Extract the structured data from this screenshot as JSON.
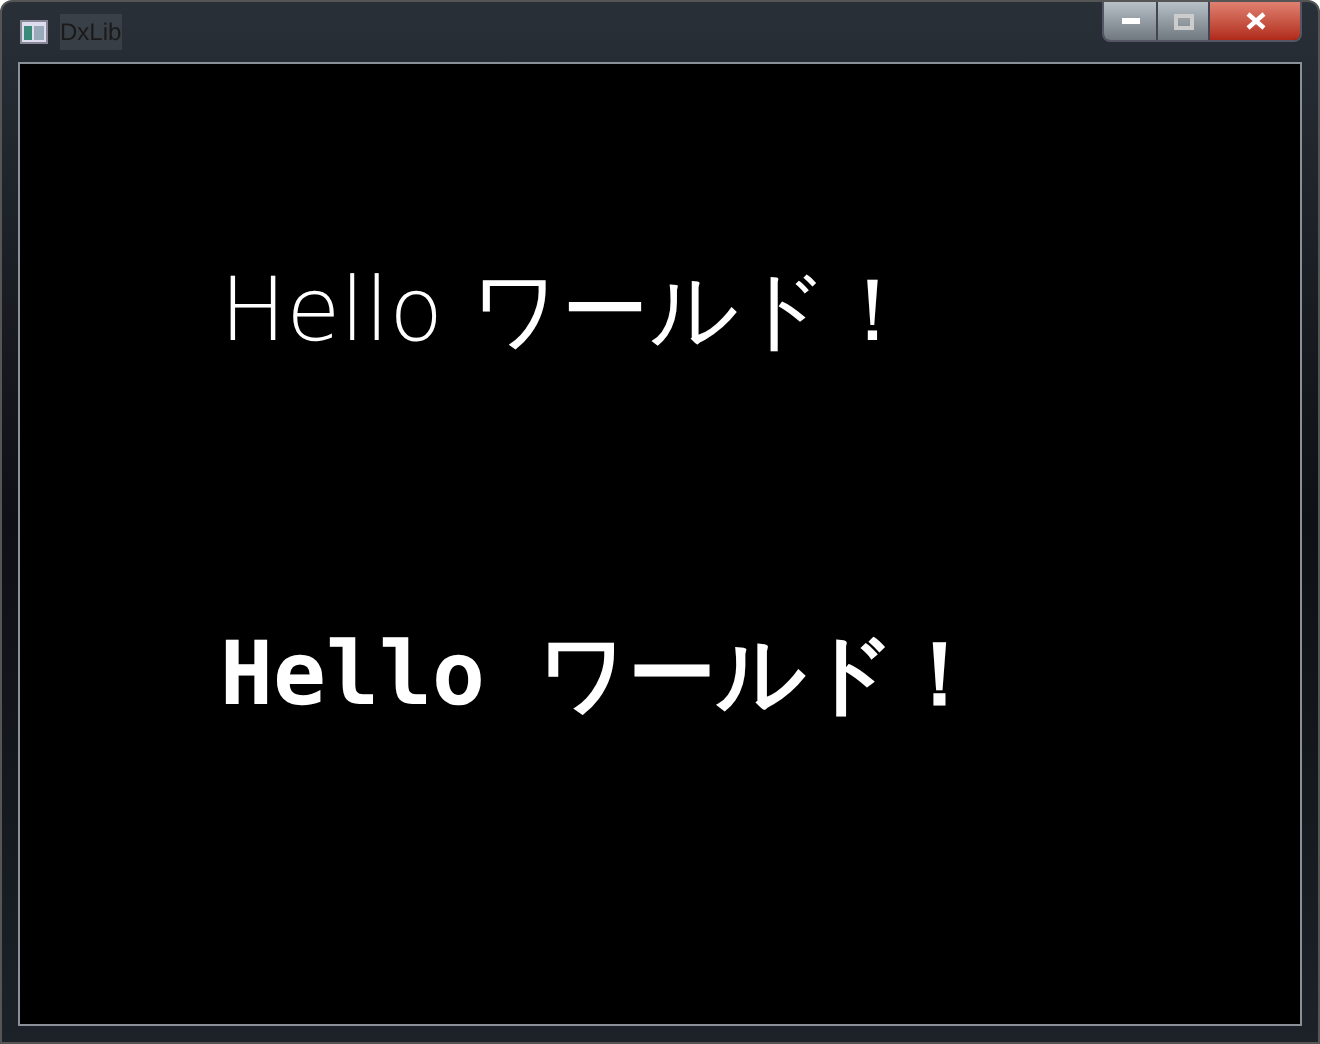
{
  "window": {
    "title": "DxLib"
  },
  "lines": [
    {
      "text": "Hello ワールド！",
      "kind": "regular"
    },
    {
      "text": "Hello ワールド！",
      "kind": "bold"
    }
  ]
}
